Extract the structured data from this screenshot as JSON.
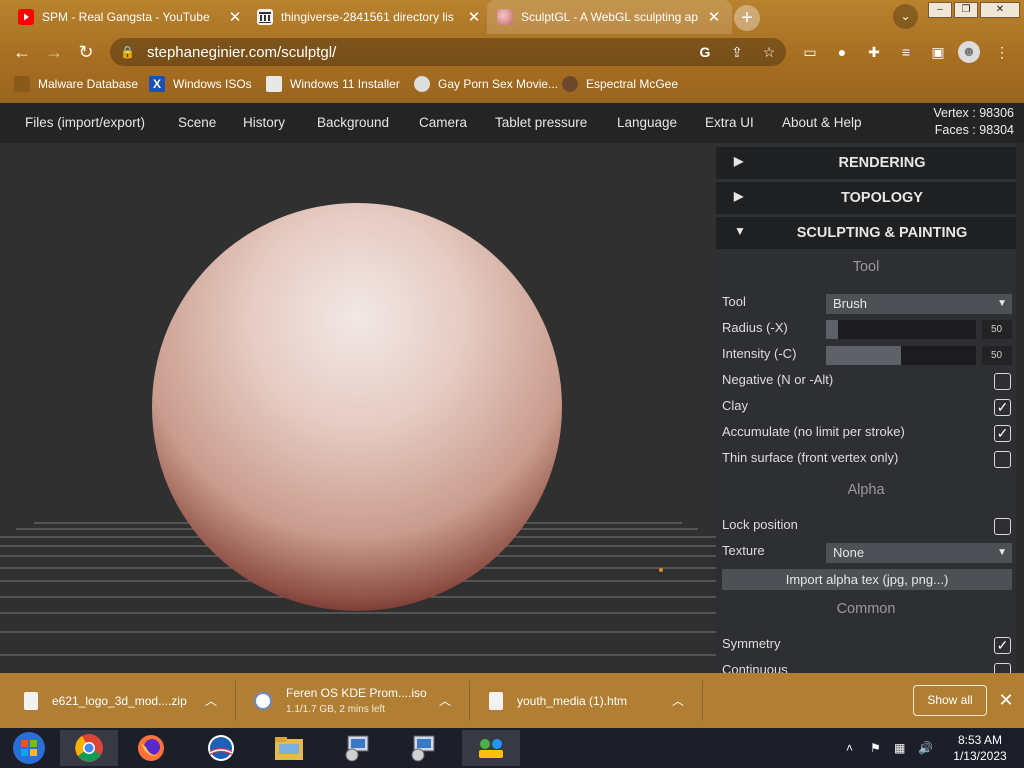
{
  "browser": {
    "tabs": [
      {
        "title": "SPM - Real Gangsta - YouTube",
        "favicon": "youtube-icon",
        "color": "#ff0000"
      },
      {
        "title": "thingiverse-2841561 directory lis",
        "favicon": "archive-icon",
        "color": "#444444"
      },
      {
        "title": "SculptGL - A WebGL sculpting ap",
        "favicon": "sculptgl-icon",
        "color": "#e88080"
      }
    ],
    "new_tab": "+",
    "address": "stephaneginier.com/sculptgl/",
    "bookmarks": [
      {
        "label": "Malware Database",
        "icon": "malware-icon"
      },
      {
        "label": "Windows ISOs",
        "icon": "x-icon"
      },
      {
        "label": "Windows 11 Installer",
        "icon": "installer-icon"
      },
      {
        "label": "Gay Porn Sex Movie...",
        "icon": "bookmark-favicon"
      },
      {
        "label": "Espectral McGee",
        "icon": "bookmark-favicon-2"
      }
    ]
  },
  "app": {
    "menu": [
      "Files (import/export)",
      "Scene",
      "History",
      "Background",
      "Camera",
      "Tablet pressure",
      "Language",
      "Extra UI",
      "About & Help"
    ],
    "vertex": "Vertex : 98306",
    "faces": "Faces : 98304",
    "panel": {
      "sections": [
        {
          "label": "RENDERING",
          "arrow": "▶"
        },
        {
          "label": "TOPOLOGY",
          "arrow": "▶"
        },
        {
          "label": "SCULPTING & PAINTING",
          "arrow": "▼"
        }
      ],
      "tool_heading": "Tool",
      "tool_label": "Tool",
      "tool_value": "Brush",
      "radius_label": "Radius (-X)",
      "radius_value": "50",
      "radius_fraction": 0.08,
      "intensity_label": "Intensity (-C)",
      "intensity_value": "50",
      "intensity_fraction": 0.5,
      "negative_label": "Negative (N or -Alt)",
      "negative_checked": false,
      "clay_label": "Clay",
      "clay_checked": true,
      "accumulate_label": "Accumulate (no limit per stroke)",
      "accumulate_checked": true,
      "thin_label": "Thin surface (front vertex only)",
      "thin_checked": false,
      "alpha_heading": "Alpha",
      "lock_label": "Lock position",
      "lock_checked": false,
      "texture_label": "Texture",
      "texture_value": "None",
      "import_label": "Import alpha tex (jpg, png...)",
      "common_heading": "Common",
      "symmetry_label": "Symmetry",
      "symmetry_checked": true,
      "continuous_label": "Continuous",
      "continuous_checked": false
    }
  },
  "downloads": {
    "items": [
      {
        "name": "e621_logo_3d_mod....zip",
        "status": ""
      },
      {
        "name": "Feren OS KDE Prom....iso",
        "status": "1.1/1.7 GB, 2 mins left"
      },
      {
        "name": "youth_media (1).htm",
        "status": ""
      }
    ],
    "show_all": "Show all"
  },
  "taskbar": {
    "apps": [
      "windows-start-icon",
      "chrome-icon",
      "firefox-icon",
      "obama-icon",
      "file-explorer-icon",
      "installer-app-icon",
      "installer-app-icon-2",
      "network-app-icon"
    ],
    "time": "8:53 AM",
    "date": "1/13/2023"
  },
  "colors": {
    "chrome_bar": "#a87024",
    "panel_bg": "#2e2f32",
    "viewport_bg": "#303030",
    "accent_downloads": "#b07f34"
  }
}
